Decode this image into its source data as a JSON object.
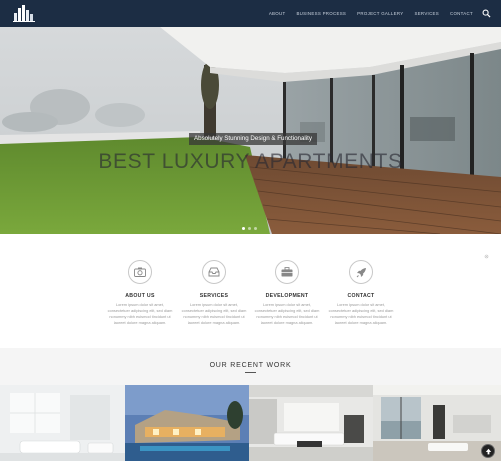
{
  "nav": {
    "logo_icon": "building-logo-icon",
    "links": [
      {
        "label": "ABOUT"
      },
      {
        "label": "BUSINESS PROCESS"
      },
      {
        "label": "PROJECT GALLERY"
      },
      {
        "label": "SERVICES"
      },
      {
        "label": "CONTACT"
      }
    ],
    "search_icon": "search-icon",
    "background": "#1c2d44"
  },
  "hero": {
    "tagline": "Absolutely Stunning Design & Functionality",
    "title": "BEST LUXURY APARTMENTS",
    "slides": 3,
    "active_slide": 1
  },
  "features": [
    {
      "icon": "camera-icon",
      "title": "ABOUT US",
      "body": [
        "Lorem ipsum dolor sit amet,",
        "consectetuer adipiscing elit, sed diam",
        "nonummy nibh euismod tincidunt ut",
        "laoreet dolore magna aliquam."
      ]
    },
    {
      "icon": "inbox-icon",
      "title": "SERVICES",
      "body": [
        "Lorem ipsum dolor sit amet,",
        "consectetuer adipiscing elit, sed diam",
        "nonummy nibh euismod tincidunt ut",
        "laoreet dolore magna aliquam."
      ]
    },
    {
      "icon": "briefcase-icon",
      "title": "DEVELOPMENT",
      "body": [
        "Lorem ipsum dolor sit amet,",
        "consectetuer adipiscing elit, sed diam",
        "nonummy nibh euismod tincidunt ut",
        "laoreet dolore magna aliquam."
      ]
    },
    {
      "icon": "rocket-icon",
      "title": "CONTACT",
      "body": [
        "Lorem ipsum dolor sit amet,",
        "consectetuer adipiscing elit, sed diam",
        "nonummy nibh euismod tincidunt ut",
        "laoreet dolore magna aliquam."
      ]
    }
  ],
  "recent_work": {
    "title": "OUR RECENT WORK"
  },
  "gallery": [
    {
      "name": "white-living-room"
    },
    {
      "name": "villa-pool-dusk"
    },
    {
      "name": "modern-lounge"
    },
    {
      "name": "city-view-interior"
    }
  ],
  "scroll_top_icon": "arrow-up-icon"
}
